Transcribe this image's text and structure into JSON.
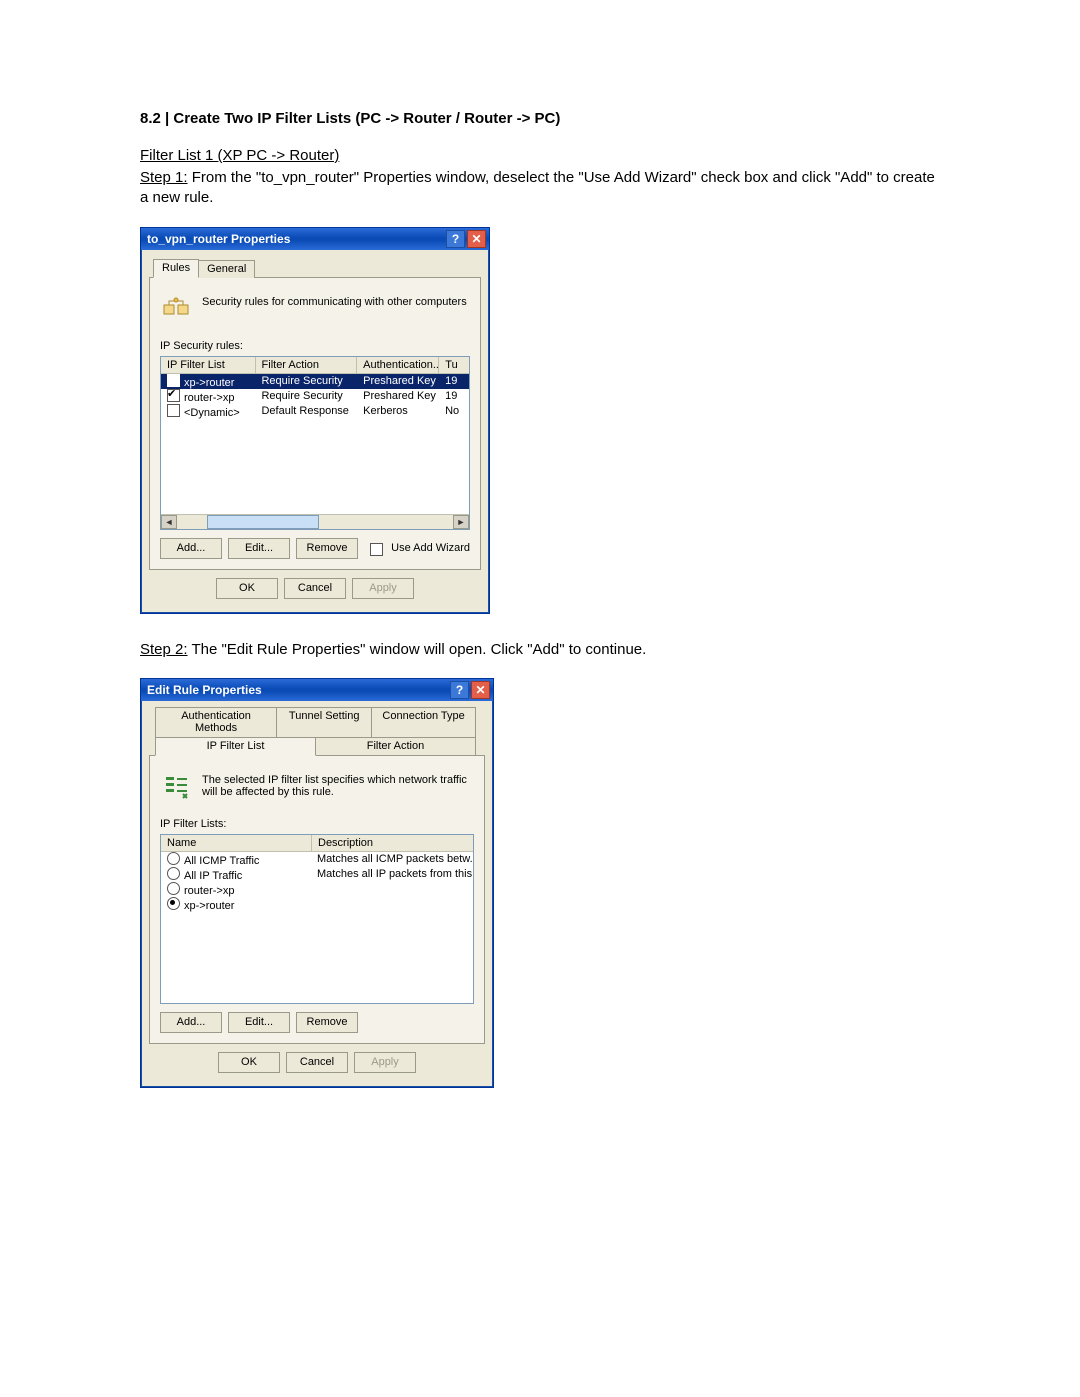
{
  "heading": "8.2 | Create Two IP Filter Lists (PC -> Router / Router -> PC)",
  "filterlist_title": "Filter List 1 (XP PC -> Router)",
  "step1_label": "Step 1:",
  "step1_text": " From the \"to_vpn_router\" Properties window, deselect the \"Use Add Wizard\" check box and click \"Add\" to create a new rule.",
  "step2_label": "Step 2:",
  "step2_text": " The \"Edit Rule Properties\" window will open. Click \"Add\" to continue.",
  "dlg1": {
    "title": "to_vpn_router Properties",
    "tab_rules": "Rules",
    "tab_general": "General",
    "desc": "Security rules for communicating with other computers",
    "rules_label": "IP Security rules:",
    "cols": {
      "c1": "IP Filter List",
      "c2": "Filter Action",
      "c3": "Authentication...",
      "c4": "Tu"
    },
    "rows": [
      {
        "checked": true,
        "selected": true,
        "c1": "xp->router",
        "c2": "Require Security",
        "c3": "Preshared Key",
        "c4": "19"
      },
      {
        "checked": true,
        "selected": false,
        "c1": "router->xp",
        "c2": "Require Security",
        "c3": "Preshared Key",
        "c4": "19"
      },
      {
        "checked": false,
        "selected": false,
        "c1": "<Dynamic>",
        "c2": "Default Response",
        "c3": "Kerberos",
        "c4": "No"
      }
    ],
    "btn_add": "Add...",
    "btn_edit": "Edit...",
    "btn_remove": "Remove",
    "wizard_label": "Use Add Wizard",
    "btn_ok": "OK",
    "btn_cancel": "Cancel",
    "btn_apply": "Apply"
  },
  "dlg2": {
    "title": "Edit Rule Properties",
    "tab_auth": "Authentication Methods",
    "tab_tunnel": "Tunnel Setting",
    "tab_conn": "Connection Type",
    "tab_filter": "IP Filter List",
    "tab_action": "Filter Action",
    "desc": "The selected IP filter list specifies which network traffic will be affected by this rule.",
    "list_label": "IP Filter Lists:",
    "cols": {
      "c1": "Name",
      "c2": "Description"
    },
    "rows": [
      {
        "sel": false,
        "c1": "All ICMP Traffic",
        "c2": "Matches all ICMP packets betw..."
      },
      {
        "sel": false,
        "c1": "All IP Traffic",
        "c2": "Matches all IP packets from this ..."
      },
      {
        "sel": false,
        "c1": "router->xp",
        "c2": ""
      },
      {
        "sel": true,
        "c1": "xp->router",
        "c2": ""
      }
    ],
    "btn_add": "Add...",
    "btn_edit": "Edit...",
    "btn_remove": "Remove",
    "btn_ok": "OK",
    "btn_cancel": "Cancel",
    "btn_apply": "Apply"
  }
}
